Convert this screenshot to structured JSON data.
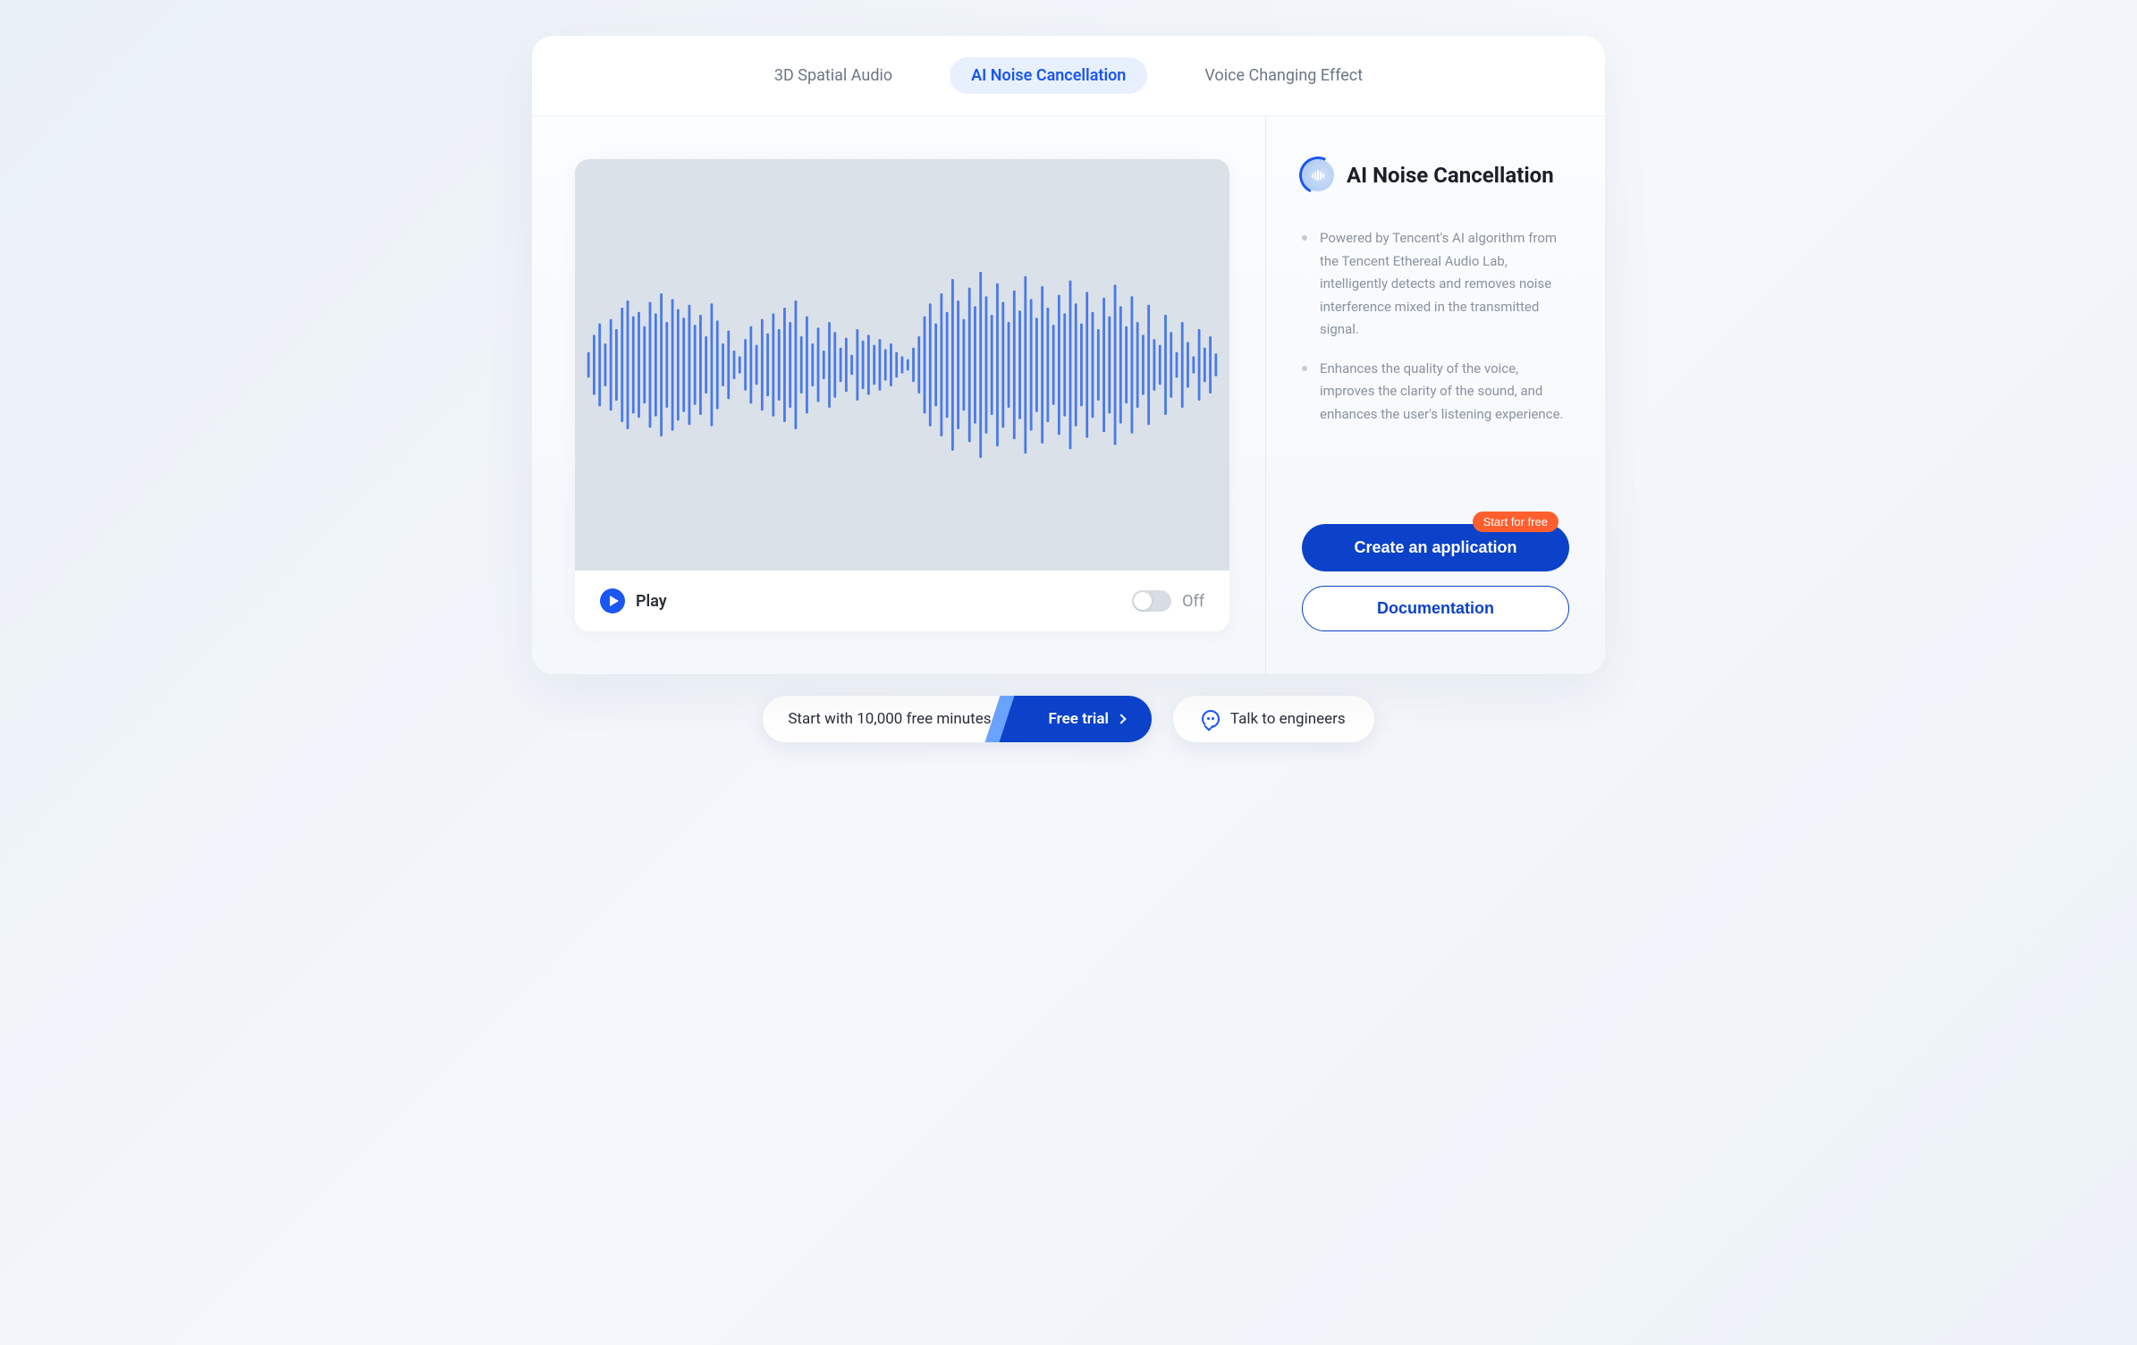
{
  "tabs": [
    {
      "label": "3D Spatial Audio",
      "active": false
    },
    {
      "label": "AI Noise Cancellation",
      "active": true
    },
    {
      "label": "Voice Changing Effect",
      "active": false
    }
  ],
  "controls": {
    "play_label": "Play",
    "toggle_label": "Off"
  },
  "feature": {
    "title": "AI Noise Cancellation",
    "bullets": [
      "Powered by Tencent's AI algorithm from the Tencent Ethereal Audio Lab, intelligently detects and removes noise interference mixed in the transmitted signal.",
      "Enhances the quality of the voice, improves the clarity of the sound, and enhances the user's listening experience."
    ]
  },
  "cta": {
    "primary": "Create an application",
    "badge": "Start for free",
    "secondary": "Documentation"
  },
  "footer": {
    "start_text": "Start with 10,000 free minutes",
    "trial_label": "Free trial",
    "engineers_label": "Talk to engineers"
  },
  "waveform_bars": [
    18,
    42,
    58,
    30,
    64,
    50,
    80,
    90,
    68,
    74,
    54,
    88,
    72,
    100,
    60,
    92,
    78,
    66,
    84,
    56,
    70,
    40,
    86,
    62,
    30,
    48,
    20,
    12,
    36,
    54,
    28,
    64,
    44,
    72,
    50,
    80,
    60,
    90,
    40,
    68,
    30,
    52,
    20,
    60,
    46,
    24,
    38,
    14,
    50,
    34,
    42,
    28,
    36,
    22,
    30,
    18,
    12,
    8,
    24,
    40,
    68,
    86,
    58,
    100,
    74,
    120,
    90,
    64,
    108,
    82,
    130,
    96,
    70,
    114,
    88,
    60,
    104,
    76,
    124,
    92,
    66,
    110,
    80,
    56,
    98,
    72,
    118,
    86,
    58,
    102,
    74,
    50,
    94,
    68,
    112,
    82,
    54,
    96,
    60,
    42,
    84,
    36,
    28,
    70,
    46,
    18,
    60,
    32,
    12,
    50,
    24,
    40,
    16
  ]
}
